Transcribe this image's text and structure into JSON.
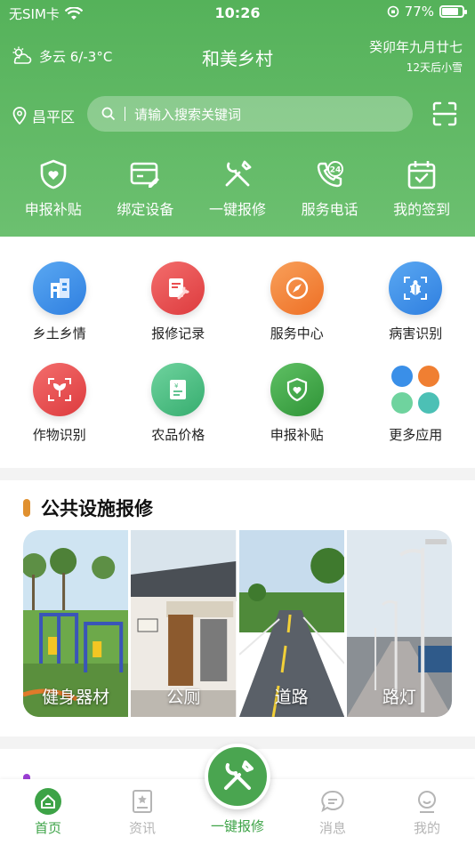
{
  "status_bar": {
    "carrier": "无SIM卡",
    "time": "10:26",
    "battery": "77%"
  },
  "header": {
    "weather": "多云 6/-3°C",
    "title": "和美乡村",
    "lunar_date": "癸卯年九月廿七",
    "forecast": "12天后小雪",
    "location": "昌平区",
    "search_placeholder": "请输入搜索关键词"
  },
  "quick_actions": [
    {
      "label": "申报补贴",
      "icon": "shield-heart-icon"
    },
    {
      "label": "绑定设备",
      "icon": "card-pen-icon"
    },
    {
      "label": "一键报修",
      "icon": "tools-icon"
    },
    {
      "label": "服务电话",
      "icon": "phone-24-icon"
    },
    {
      "label": "我的签到",
      "icon": "calendar-check-icon"
    }
  ],
  "grid_menu": [
    {
      "label": "乡土乡情",
      "icon": "building-icon",
      "color": "#3a8fe8"
    },
    {
      "label": "报修记录",
      "icon": "record-wrench-icon",
      "color": "#ea4d4f"
    },
    {
      "label": "服务中心",
      "icon": "compass-icon",
      "color": "#f07f32"
    },
    {
      "label": "病害识别",
      "icon": "bug-scan-icon",
      "color": "#3a8fe8"
    },
    {
      "label": "作物识别",
      "icon": "sprout-scan-icon",
      "color": "#ea4d4f"
    },
    {
      "label": "农品价格",
      "icon": "price-card-icon",
      "color": "#4cbc83"
    },
    {
      "label": "申报补贴",
      "icon": "shield-heart-icon",
      "color": "#3da347"
    },
    {
      "label": "更多应用",
      "icon": "apps-dots-icon",
      "color": "#3a8fe8"
    }
  ],
  "facility_section": {
    "title": "公共设施报修",
    "items": [
      {
        "label": "健身器材"
      },
      {
        "label": "公厕"
      },
      {
        "label": "道路"
      },
      {
        "label": "路灯"
      }
    ]
  },
  "bottom_nav": {
    "items": [
      {
        "label": "首页",
        "icon": "home-icon"
      },
      {
        "label": "资讯",
        "icon": "news-icon"
      },
      {
        "label": "一键报修",
        "icon": "tools-icon"
      },
      {
        "label": "消息",
        "icon": "message-icon"
      },
      {
        "label": "我的",
        "icon": "profile-icon"
      }
    ]
  },
  "colors": {
    "brand_green": "#55b25a",
    "active_nav": "#3da347",
    "section_bar": "#e0902f"
  }
}
